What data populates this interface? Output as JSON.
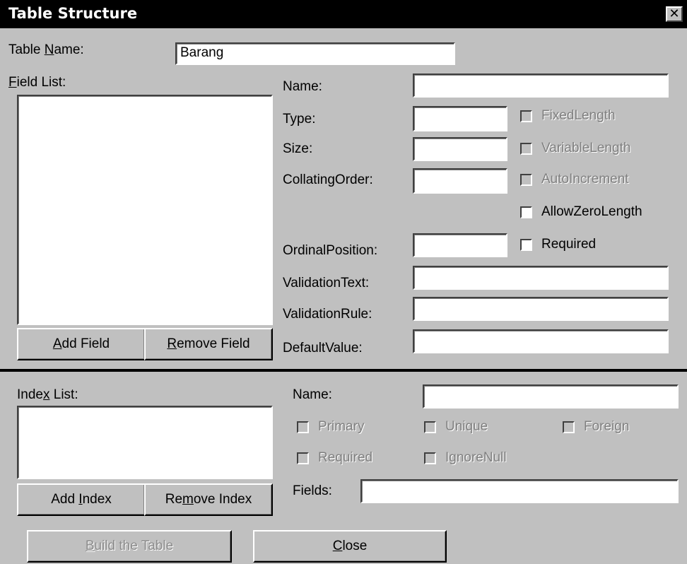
{
  "window": {
    "title": "Table Structure",
    "close_glyph": "✕"
  },
  "table": {
    "name_label": "Table Name:",
    "name_value": "Barang"
  },
  "field_list": {
    "label": "Field List:"
  },
  "field": {
    "name_label": "Name:",
    "type_label": "Type:",
    "size_label": "Size:",
    "collating_label": "CollatingOrder:",
    "ordinal_label": "OrdinalPosition:",
    "validation_text_label": "ValidationText:",
    "validation_rule_label": "ValidationRule:",
    "default_value_label": "DefaultValue:",
    "fixed_length": "FixedLength",
    "variable_length": "VariableLength",
    "auto_increment": "AutoIncrement",
    "allow_zero_length": "AllowZeroLength",
    "required": "Required"
  },
  "buttons": {
    "add_field": "Add Field",
    "remove_field": "Remove Field",
    "add_index": "Add Index",
    "remove_index": "Remove Index",
    "build_table": "Build the Table",
    "close": "Close"
  },
  "index_list": {
    "label": "Index List:"
  },
  "index": {
    "name_label": "Name:",
    "primary": "Primary",
    "unique": "Unique",
    "foreign": "Foreign",
    "required": "Required",
    "ignore_null": "IgnoreNull",
    "fields_label": "Fields:"
  },
  "mnemonics": {
    "table_name": {
      "before": "Table ",
      "key": "N",
      "after": "ame:"
    },
    "field_list": {
      "before": "",
      "key": "F",
      "after": "ield List:"
    },
    "index_list": {
      "before": "Inde",
      "key": "x",
      "after": " List:"
    },
    "add_field": {
      "before": "",
      "key": "A",
      "after": "dd Field"
    },
    "remove_field": {
      "before": "",
      "key": "R",
      "after": "emove Field"
    },
    "add_index": {
      "before": "Add ",
      "key": "I",
      "after": "ndex"
    },
    "remove_index": {
      "before": "Re",
      "key": "m",
      "after": "ove Index"
    },
    "build_table": {
      "before": "",
      "key": "B",
      "after": "uild the Table"
    },
    "close": {
      "before": "",
      "key": "C",
      "after": "lose"
    }
  }
}
